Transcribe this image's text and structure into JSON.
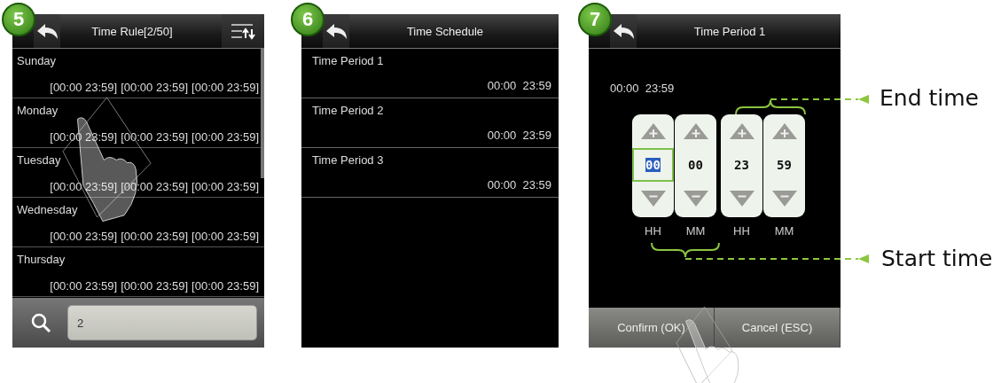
{
  "screens": [
    {
      "kind": "rule-list",
      "badge": "5",
      "title": "Time Rule[2/50]",
      "rules": [
        {
          "day": "Sunday",
          "periods": [
            "[00:00 23:59]",
            "[00:00 23:59]",
            "[00:00 23:59]"
          ]
        },
        {
          "day": "Monday",
          "periods": [
            "[00:00 23:59]",
            "[00:00 23:59]",
            "[00:00 23:59]"
          ]
        },
        {
          "day": "Tuesday",
          "periods": [
            "[00:00 23:59]",
            "[00:00 23:59]",
            "[00:00 23:59]"
          ]
        },
        {
          "day": "Wednesday",
          "periods": [
            "[00:00 23:59]",
            "[00:00 23:59]",
            "[00:00 23:59]"
          ]
        },
        {
          "day": "Thursday",
          "periods": [
            "[00:00 23:59]",
            "[00:00 23:59]",
            "[00:00 23:59]"
          ]
        }
      ],
      "search": {
        "value": "2"
      }
    },
    {
      "kind": "schedule",
      "badge": "6",
      "title": "Time Schedule",
      "periods": [
        {
          "name": "Time Period 1",
          "range": "00:00  23:59"
        },
        {
          "name": "Time Period 2",
          "range": "00:00  23:59"
        },
        {
          "name": "Time Period 3",
          "range": "00:00  23:59"
        }
      ]
    },
    {
      "kind": "period-edit",
      "badge": "7",
      "title": "Time Period 1",
      "range": "00:00  23:59",
      "spinners": [
        {
          "value": "00",
          "label": "HH",
          "selected": true
        },
        {
          "value": "00",
          "label": "MM",
          "selected": false
        },
        {
          "value": "23",
          "label": "HH",
          "selected": false
        },
        {
          "value": "59",
          "label": "MM",
          "selected": false
        }
      ],
      "buttons": [
        "Confirm (OK)",
        "Cancel (ESC)"
      ],
      "callouts": [
        {
          "label": "End time"
        },
        {
          "label": "Start time"
        }
      ]
    }
  ]
}
